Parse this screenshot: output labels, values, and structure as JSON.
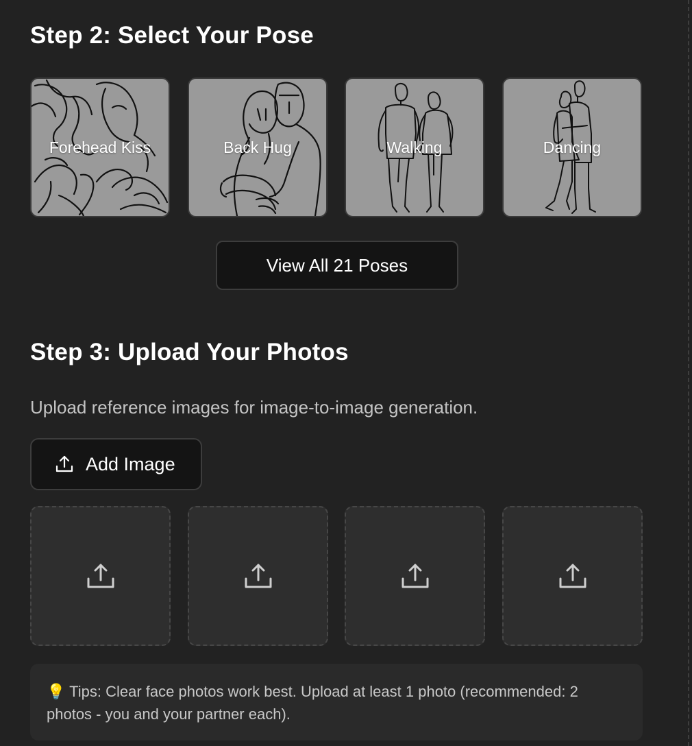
{
  "step2": {
    "title": "Step 2: Select Your Pose",
    "poses": [
      {
        "label": "Forehead Kiss",
        "icon": "forehead-kiss-illustration"
      },
      {
        "label": "Back Hug",
        "icon": "back-hug-illustration"
      },
      {
        "label": "Walking",
        "icon": "walking-illustration"
      },
      {
        "label": "Dancing",
        "icon": "dancing-illustration"
      }
    ],
    "view_all_label": "View All 21 Poses"
  },
  "step3": {
    "title": "Step 3: Upload Your Photos",
    "description": "Upload reference images for image-to-image generation.",
    "add_image_label": "Add Image",
    "upload_slots": [
      {
        "icon": "upload-icon"
      },
      {
        "icon": "upload-icon"
      },
      {
        "icon": "upload-icon"
      },
      {
        "icon": "upload-icon"
      }
    ],
    "tips_icon": "💡",
    "tips_text": "Tips: Clear face photos work best. Upload at least 1 photo (recommended: 2 photos - you and your partner each)."
  },
  "colors": {
    "background": "#222222",
    "card_gray": "#9a9a9a",
    "button_bg": "#141414",
    "slot_bg": "#2e2e2e",
    "tips_bg": "#2a2a2a"
  }
}
